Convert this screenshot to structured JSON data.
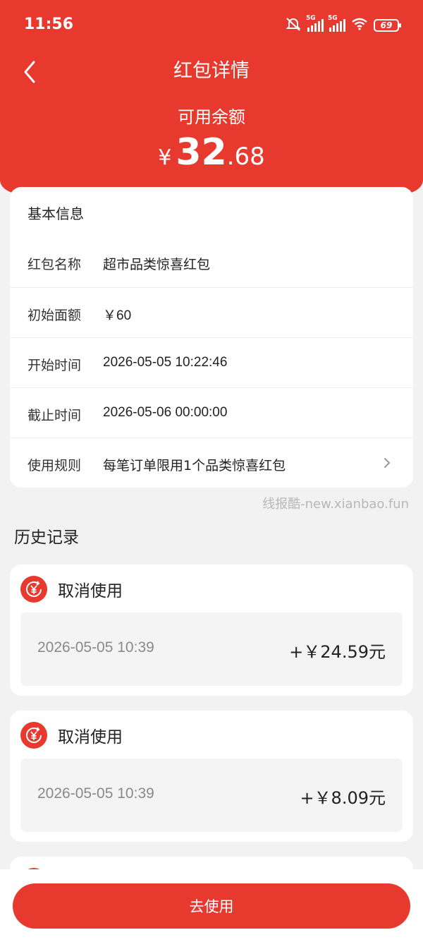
{
  "status_bar": {
    "time": "11:56",
    "network_1": "5G",
    "network_2": "5G",
    "battery": "69",
    "icons": [
      "mute-vibrate-icon",
      "signal-icon",
      "signal-icon",
      "wifi-icon",
      "battery-icon"
    ]
  },
  "nav": {
    "back_icon": "chevron-left-icon",
    "title": "红包详情"
  },
  "balance": {
    "label": "可用余额",
    "currency": "¥",
    "integer": "32",
    "decimal": ".68"
  },
  "basic_info": {
    "title": "基本信息",
    "rows": [
      {
        "label": "红包名称",
        "value": "超市品类惊喜红包"
      },
      {
        "label": "初始面额",
        "value": "￥60"
      },
      {
        "label": "开始时间",
        "value": "2026-05-05 10:22:46"
      },
      {
        "label": "截止时间",
        "value": "2026-05-06 00:00:00"
      },
      {
        "label": "使用规则",
        "value": "每笔订单限用1个品类惊喜红包"
      }
    ]
  },
  "watermark": "线报酷-new.xianbao.fun",
  "history": {
    "title": "历史记录",
    "records": [
      {
        "type": "取消使用",
        "time": "2026-05-05 10:39",
        "amount": "+￥24.59元",
        "icon": "coin-return-icon"
      },
      {
        "type": "取消使用",
        "time": "2026-05-05 10:39",
        "amount": "+￥8.09元",
        "icon": "coin-return-icon"
      }
    ]
  },
  "footer": {
    "button_label": "去使用"
  },
  "colors": {
    "primary_red": "#e8392e",
    "background": "#f2f2f2"
  }
}
